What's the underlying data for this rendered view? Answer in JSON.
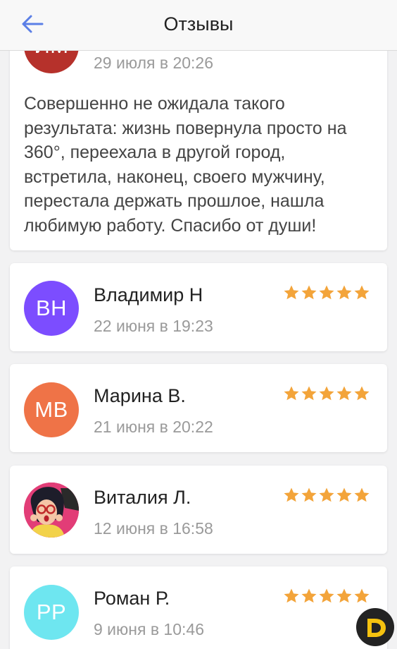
{
  "header": {
    "title": "Отзывы"
  },
  "colors": {
    "accent": "#5b7fe6",
    "star": "#f3a43a",
    "logo": "#f5c20f"
  },
  "first_review": {
    "initials": "ИМ",
    "avatar_color": "#b6312b",
    "date": "29 июля в 20:26",
    "text": "Совершенно не ожидала такого результата: жизнь повернула просто на 360°, переехала в другой город, встретила, наконец, своего мужчину, перестала держать прошлое, нашла любимую работу. Спасибо от души!"
  },
  "reviews": [
    {
      "initials": "ВН",
      "name": "Владимир Н",
      "date": "22 июня в 19:23",
      "avatar_color": "#7c4dff",
      "rating": 5
    },
    {
      "initials": "МВ",
      "name": "Марина В.",
      "date": "21 июня в 20:22",
      "avatar_color": "#ef7347",
      "rating": 5
    },
    {
      "initials": "",
      "name": "Виталия Л.",
      "date": "12 июня в 16:58",
      "avatar_color": "#d8346c",
      "rating": 5
    },
    {
      "initials": "РР",
      "name": "Роман Р.",
      "date": "9 июня в 10:46",
      "avatar_color": "#6ee6f0",
      "rating": 5
    }
  ]
}
